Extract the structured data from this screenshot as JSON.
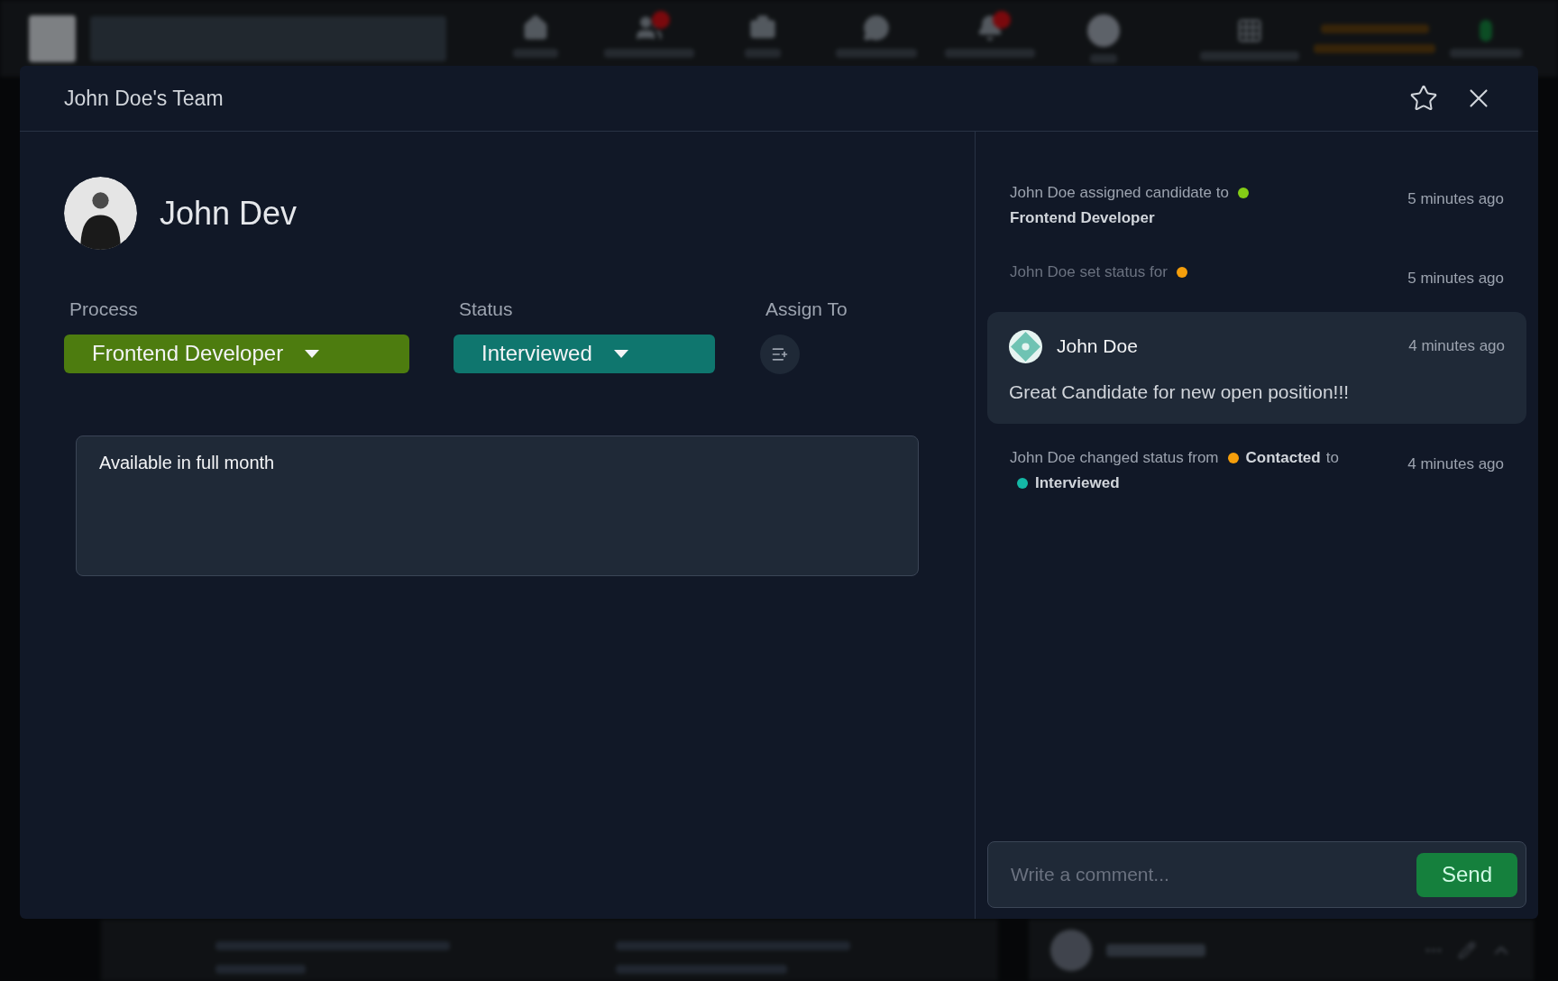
{
  "background": {
    "nav": [
      {
        "badge": false
      },
      {
        "badge": true
      },
      {
        "badge": false
      },
      {
        "badge": false
      },
      {
        "badge": true
      },
      {
        "badge": false
      }
    ]
  },
  "modal": {
    "title": "John Doe's Team",
    "candidate": {
      "name": "John Dev"
    },
    "fields": [
      {
        "label": "Process",
        "kind": "dropdown",
        "value": "Frontend Developer",
        "color": "#4d7c0f"
      },
      {
        "label": "Status",
        "kind": "dropdown",
        "value": "Interviewed",
        "color": "#0f766e"
      },
      {
        "label": "Assign To",
        "kind": "assign"
      }
    ],
    "note": "Available in full month",
    "activity": [
      {
        "kind": "event",
        "parts": [
          {
            "text": "John Doe assigned candidate to"
          },
          {
            "color": "#84cc16"
          },
          {
            "strong": "Frontend Developer"
          }
        ],
        "time": "5 minutes ago",
        "faded": false
      },
      {
        "kind": "event",
        "parts": [
          {
            "text": "John Doe set status for"
          },
          {
            "color": "#f59e0b"
          }
        ],
        "time": "5 minutes ago",
        "faded": true
      },
      {
        "kind": "comment",
        "author": "John Doe",
        "body": "Great Candidate for new open position!!!",
        "time": "4 minutes ago"
      },
      {
        "kind": "event",
        "parts": [
          {
            "text": "John Doe changed status from"
          },
          {
            "color": "#f59e0b"
          },
          {
            "strong": "Contacted"
          },
          {
            "text": "to"
          },
          {
            "color": "#14b8a6"
          },
          {
            "strong": "Interviewed"
          }
        ],
        "time": "4 minutes ago",
        "faded": false
      }
    ],
    "comment_box": {
      "placeholder": "Write a comment...",
      "button": "Send"
    }
  }
}
